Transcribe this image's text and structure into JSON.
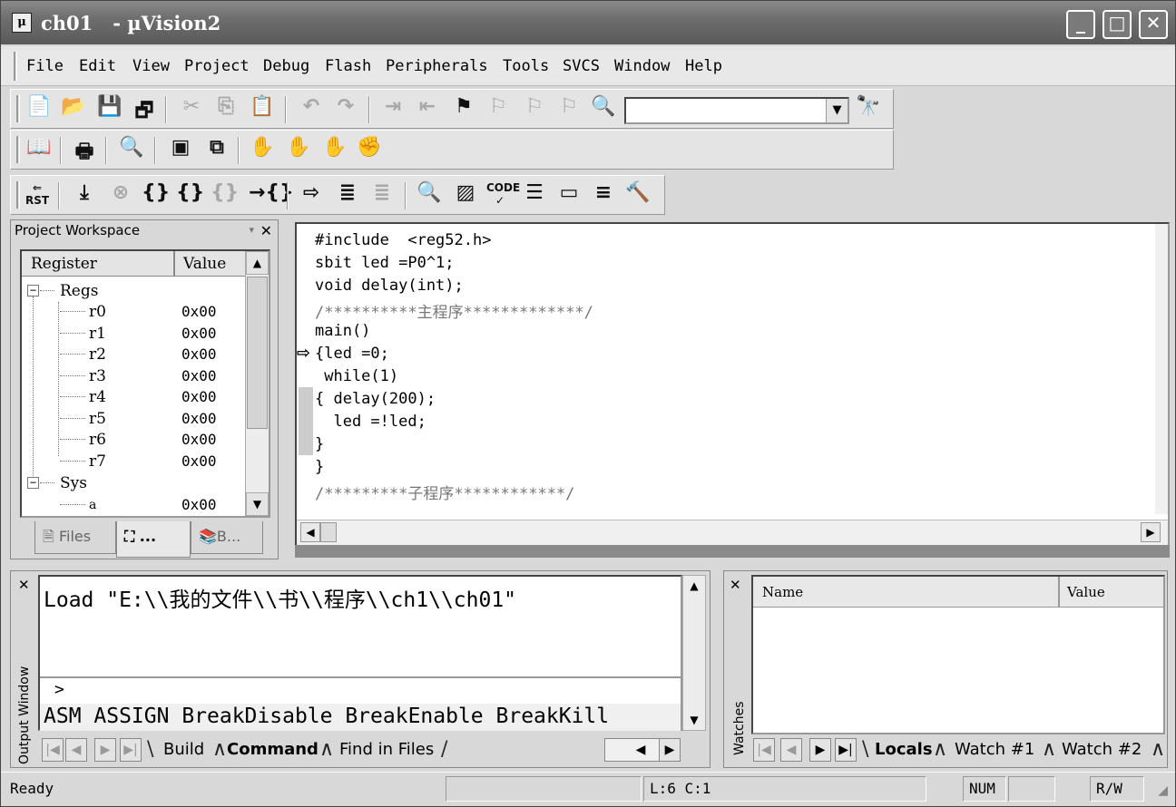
{
  "window": {
    "title": "ch01   - µVision2",
    "app_icon": "uvision-icon"
  },
  "menu": [
    "File",
    "Edit",
    "View",
    "Project",
    "Debug",
    "Flash",
    "Peripherals",
    "Tools",
    "SVCS",
    "Window",
    "Help"
  ],
  "workspace": {
    "title": "Project Workspace",
    "columns": [
      "Register",
      "Value"
    ],
    "groups": [
      {
        "name": "Regs",
        "items": [
          {
            "name": "r0",
            "value": "0x00"
          },
          {
            "name": "r1",
            "value": "0x00"
          },
          {
            "name": "r2",
            "value": "0x00"
          },
          {
            "name": "r3",
            "value": "0x00"
          },
          {
            "name": "r4",
            "value": "0x00"
          },
          {
            "name": "r5",
            "value": "0x00"
          },
          {
            "name": "r6",
            "value": "0x00"
          },
          {
            "name": "r7",
            "value": "0x00"
          }
        ]
      },
      {
        "name": "Sys",
        "items": [
          {
            "name": "a",
            "value": "0x00"
          }
        ]
      }
    ],
    "tabs": [
      "Files",
      "...",
      "B..."
    ]
  },
  "editor": {
    "lines": [
      "#include  <reg52.h>",
      "sbit led =P0^1;",
      "void delay(int);",
      "/**********主程序*************/",
      "main()",
      "{led =0;",
      " while(1)",
      "{ delay(200);",
      "  led =!led;",
      "}",
      "}",
      "/*********子程序************/"
    ]
  },
  "output": {
    "side_label": "Output Window",
    "load_line": "Load \"E:\\\\我的文件\\\\书\\\\程序\\\\ch1\\\\ch01\"",
    "prompt": ">",
    "commands": "ASM ASSIGN BreakDisable BreakEnable BreakKill",
    "tabs": [
      "Build",
      "Command",
      "Find in Files"
    ],
    "active_tab": "Command"
  },
  "watch": {
    "side_label": "Watches",
    "columns": [
      "Name",
      "Value"
    ],
    "tabs": [
      "Locals",
      "Watch #1",
      "Watch #2"
    ],
    "active_tab": "Locals"
  },
  "status": {
    "ready": "Ready",
    "position": "L:6 C:1",
    "num": "NUM",
    "rw": "R/W"
  }
}
